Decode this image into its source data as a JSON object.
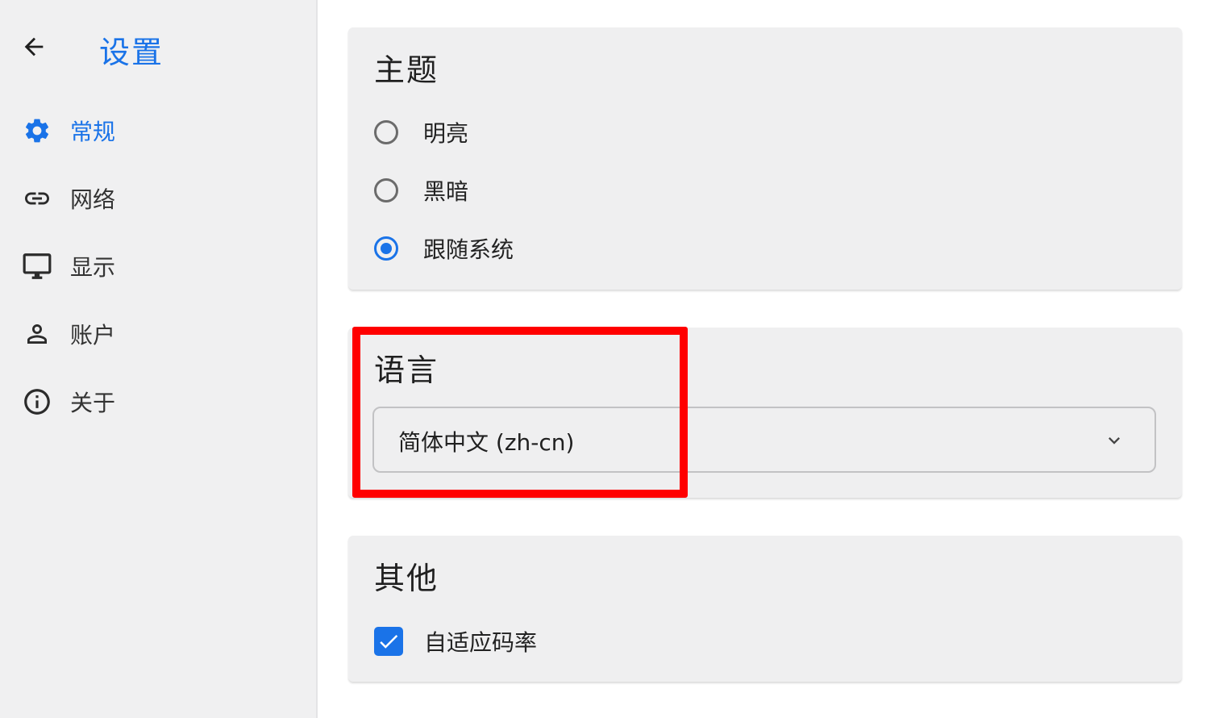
{
  "sidebar": {
    "back_icon": "arrow-left-icon",
    "title": "设置",
    "items": [
      {
        "label": "常规",
        "icon": "gear-icon",
        "active": true
      },
      {
        "label": "网络",
        "icon": "link-icon",
        "active": false
      },
      {
        "label": "显示",
        "icon": "monitor-icon",
        "active": false
      },
      {
        "label": "账户",
        "icon": "person-icon",
        "active": false
      },
      {
        "label": "关于",
        "icon": "info-icon",
        "active": false
      }
    ]
  },
  "theme": {
    "title": "主题",
    "options": [
      {
        "label": "明亮",
        "checked": false
      },
      {
        "label": "黑暗",
        "checked": false
      },
      {
        "label": "跟随系统",
        "checked": true
      }
    ]
  },
  "language": {
    "title": "语言",
    "selected": "简体中文 (zh-cn)",
    "chevron_icon": "chevron-down-icon"
  },
  "other": {
    "title": "其他",
    "checkbox": {
      "label": "自适应码率",
      "checked": true
    }
  },
  "colors": {
    "accent": "#1a73e8",
    "highlight": "#ff0000",
    "sidebar_bg": "#f0f0f1",
    "card_bg": "#efeff0"
  }
}
